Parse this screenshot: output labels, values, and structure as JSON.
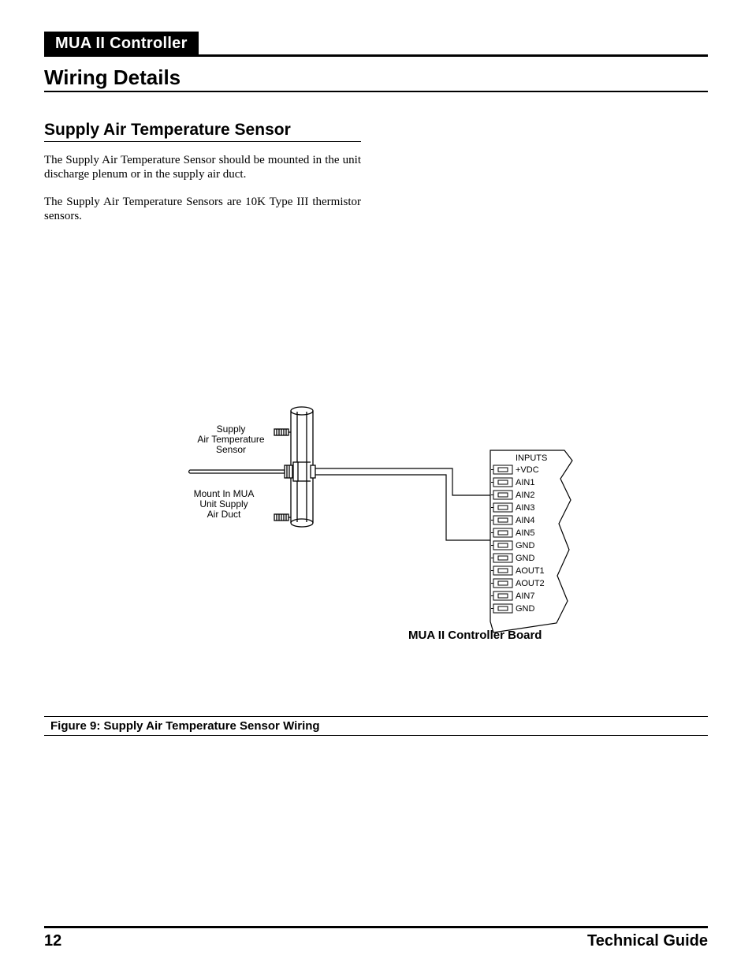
{
  "header": {
    "tag": "MUA II Controller",
    "section": "Wiring Details"
  },
  "subsection": {
    "title": "Supply Air Temperature Sensor",
    "para1": "The Supply Air Temperature Sensor should be mounted in the unit discharge plenum or in the supply air duct.",
    "para2": "The Supply Air Temperature Sensors are 10K Type III thermistor sensors."
  },
  "diagram": {
    "sensor_label_l1": "Supply",
    "sensor_label_l2": "Air Temperature",
    "sensor_label_l3": "Sensor",
    "mount_label_l1": "Mount In MUA",
    "mount_label_l2": "Unit Supply",
    "mount_label_l3": "Air Duct",
    "inputs_header": "INPUTS",
    "terminals": [
      "+VDC",
      "AIN1",
      "AIN2",
      "AIN3",
      "AIN4",
      "AIN5",
      "GND",
      "GND",
      "AOUT1",
      "AOUT2",
      "AIN7",
      "GND"
    ],
    "board_caption": "MUA II Controller Board"
  },
  "figure_caption": "Figure 9:  Supply Air Temperature Sensor Wiring",
  "footer": {
    "page": "12",
    "doc": "Technical Guide"
  }
}
